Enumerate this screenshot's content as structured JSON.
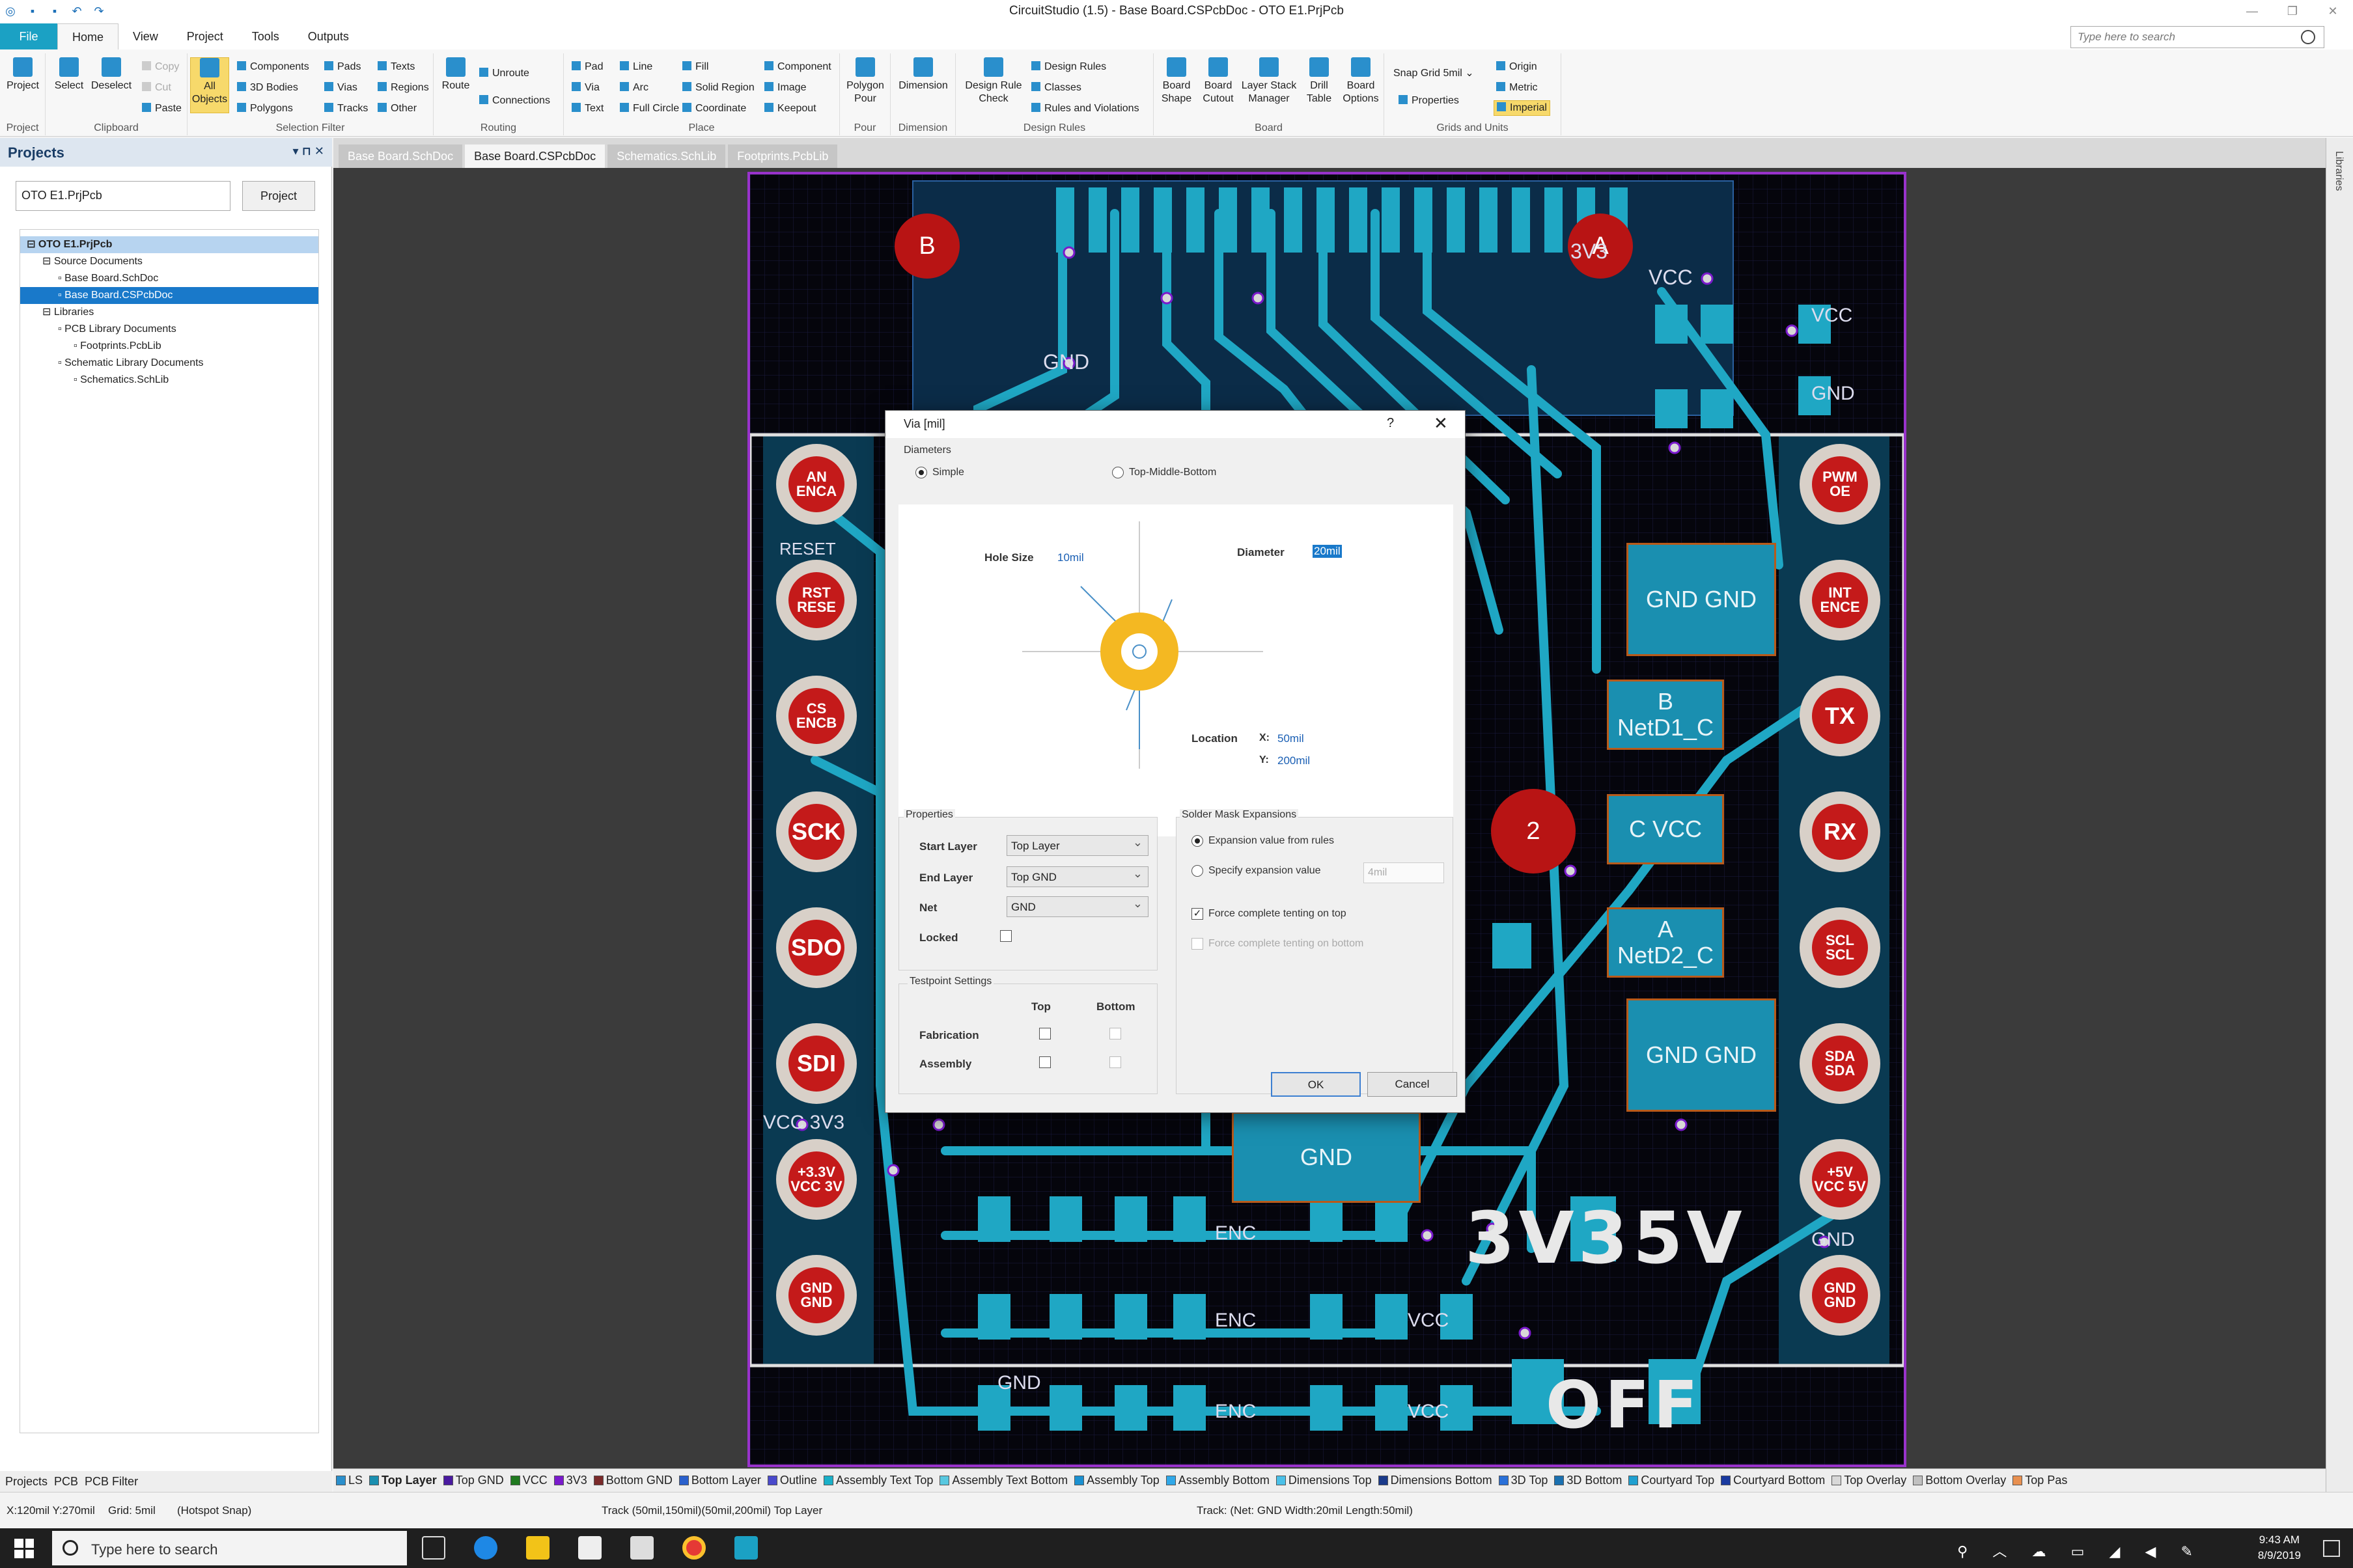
{
  "window": {
    "title": "CircuitStudio (1.5) - Base Board.CSPcbDoc - OTO E1.PrjPcb"
  },
  "ribbon": {
    "tabs": [
      "File",
      "Home",
      "View",
      "Project",
      "Tools",
      "Outputs"
    ],
    "search_placeholder": "Type here to search",
    "groups": {
      "project": {
        "label": "Project",
        "item": "Project"
      },
      "clipboard": {
        "label": "Clipboard",
        "select": "Select",
        "deselect": "Deselect",
        "copy": "Copy",
        "cut": "Cut",
        "paste": "Paste"
      },
      "selection_filter": {
        "label": "Selection Filter",
        "all_objects": "All Objects",
        "components": "Components",
        "bodies": "3D Bodies",
        "polygons": "Polygons",
        "pads": "Pads",
        "vias": "Vias",
        "tracks": "Tracks",
        "texts": "Texts",
        "regions": "Regions",
        "other": "Other"
      },
      "routing": {
        "label": "Routing",
        "route": "Route",
        "unroute": "Unroute",
        "connections": "Connections"
      },
      "place": {
        "label": "Place",
        "pad": "Pad",
        "via": "Via",
        "text": "Text",
        "line": "Line",
        "arc": "Arc",
        "full_circle": "Full Circle",
        "fill": "Fill",
        "solid_region": "Solid Region",
        "coordinate": "Coordinate",
        "component": "Component",
        "image": "Image",
        "keepout": "Keepout"
      },
      "pour": {
        "label": "Pour",
        "polygon_pour": "Polygon Pour"
      },
      "dimension": {
        "label": "Dimension",
        "dimension": "Dimension"
      },
      "design_rules": {
        "label": "Design Rules",
        "drc": "Design Rule Check",
        "rules": "Design Rules",
        "classes": "Classes",
        "rules_violations": "Rules and Violations"
      },
      "board": {
        "label": "Board",
        "board_shape": "Board Shape",
        "board_cutout": "Board Cutout",
        "layer_stack": "Layer Stack Manager",
        "drill_table": "Drill Table",
        "board_options": "Board Options"
      },
      "grids": {
        "label": "Grids and Units",
        "snap_grid": "Snap Grid",
        "snap_value": "5mil",
        "origin": "Origin",
        "metric": "Metric",
        "imperial": "Imperial",
        "properties": "Properties"
      }
    }
  },
  "projects_panel": {
    "title": "Projects",
    "search_value": "OTO E1.PrjPcb",
    "button": "Project",
    "tree": [
      {
        "label": "OTO E1.PrjPcb",
        "level": 0,
        "state": "root"
      },
      {
        "label": "Source Documents",
        "level": 1
      },
      {
        "label": "Base Board.SchDoc",
        "level": 2
      },
      {
        "label": "Base Board.CSPcbDoc",
        "level": 2,
        "state": "selected"
      },
      {
        "label": "Libraries",
        "level": 1
      },
      {
        "label": "PCB Library Documents",
        "level": 2
      },
      {
        "label": "Footprints.PcbLib",
        "level": 3
      },
      {
        "label": "Schematic Library Documents",
        "level": 2
      },
      {
        "label": "Schematics.SchLib",
        "level": 3
      }
    ],
    "bottom_tabs": [
      "Projects",
      "PCB",
      "PCB Filter"
    ]
  },
  "doc_tabs": [
    "Base Board.SchDoc",
    "Base Board.CSPcbDoc",
    "Schematics.SchLib",
    "Footprints.PcbLib"
  ],
  "libraries_side": "Libraries",
  "board": {
    "header_left": [
      "AN ENCA",
      "RST RESE",
      "CS ENCB",
      "SCK",
      "SDO",
      "SDI",
      "+3.3V VCC 3V",
      "GND GND"
    ],
    "header_right": [
      "PWM OE",
      "INT ENCE",
      "TX",
      "RX",
      "SCL SCL",
      "SDA SDA",
      "+5V VCC 5V",
      "GND GND"
    ],
    "markers": [
      "B",
      "A",
      "2"
    ],
    "chips": [
      "GND GND",
      "B NetD1_C",
      "C VCC",
      "A NetD2_C",
      "GND GND",
      "GND"
    ],
    "silk": {
      "v3": "3V3",
      "v5": "5V",
      "off": "OFF"
    },
    "nets": [
      "VCC",
      "3V3",
      "GND",
      "RESET",
      "VCC 3V3",
      "VCC",
      "GND",
      "ENC",
      "ENC",
      "ENC",
      "VCC",
      "VCC",
      "GND",
      "GND"
    ]
  },
  "dialog": {
    "title": "Via [mil]",
    "help": "?",
    "close": "✕",
    "diameters_label": "Diameters",
    "simple": "Simple",
    "tmb": "Top-Middle-Bottom",
    "hole_size_label": "Hole Size",
    "hole_size": "10mil",
    "diameter_label": "Diameter",
    "diameter": "20mil",
    "location_label": "Location",
    "x_label": "X:",
    "x": "50mil",
    "y_label": "Y:",
    "y": "200mil",
    "properties_label": "Properties",
    "start_layer_label": "Start Layer",
    "start_layer": "Top Layer",
    "end_layer_label": "End Layer",
    "end_layer": "Top GND",
    "net_label": "Net",
    "net": "GND",
    "locked_label": "Locked",
    "testpoint_label": "Testpoint Settings",
    "tp_top": "Top",
    "tp_bottom": "Bottom",
    "fabrication": "Fabrication",
    "assembly": "Assembly",
    "mask_label": "Solder Mask Expansions",
    "mask_rules": "Expansion value from rules",
    "mask_specify": "Specify expansion value",
    "mask_value": "4mil",
    "tent_top": "Force complete tenting on top",
    "tent_bottom": "Force complete tenting on bottom",
    "ok": "OK",
    "cancel": "Cancel"
  },
  "layers": [
    {
      "name": "LS",
      "color": "#2a8fcc"
    },
    {
      "name": "Top Layer",
      "color": "#1a8fb0",
      "current": true
    },
    {
      "name": "Top GND",
      "color": "#4a1aa0"
    },
    {
      "name": "VCC",
      "color": "#207a20"
    },
    {
      "name": "3V3",
      "color": "#7a1acc"
    },
    {
      "name": "Bottom GND",
      "color": "#7a2a2a"
    },
    {
      "name": "Bottom Layer",
      "color": "#2a60cc"
    },
    {
      "name": "Outline",
      "color": "#4a4acc"
    },
    {
      "name": "Assembly Text Top",
      "color": "#1ab0c8"
    },
    {
      "name": "Assembly Text Bottom",
      "color": "#58c8e0"
    },
    {
      "name": "Assembly Top",
      "color": "#1a90d0"
    },
    {
      "name": "Assembly Bottom",
      "color": "#30a8e8"
    },
    {
      "name": "Dimensions Top",
      "color": "#4ac0e8"
    },
    {
      "name": "Dimensions Bottom",
      "color": "#1a3a8a"
    },
    {
      "name": "3D Top",
      "color": "#2a70d8"
    },
    {
      "name": "3D Bottom",
      "color": "#1a70b0"
    },
    {
      "name": "Courtyard Top",
      "color": "#20a0d0"
    },
    {
      "name": "Courtyard Bottom",
      "color": "#1a3aa0"
    },
    {
      "name": "Top Overlay",
      "color": "#d8d8d8"
    },
    {
      "name": "Bottom Overlay",
      "color": "#c0c0c0"
    },
    {
      "name": "Top Pas",
      "color": "#e89050"
    }
  ],
  "status": {
    "coords": "X:120mil Y:270mil",
    "grid": "Grid: 5mil",
    "snap": "(Hotspot Snap)",
    "track": "Track (50mil,150mil)(50mil,200mil)  Top Layer",
    "track_info": "Track: (Net: GND Width:20mil Length:50mil)"
  },
  "taskbar": {
    "search": "Type here to search",
    "time": "9:43 AM",
    "date": "8/9/2019"
  }
}
